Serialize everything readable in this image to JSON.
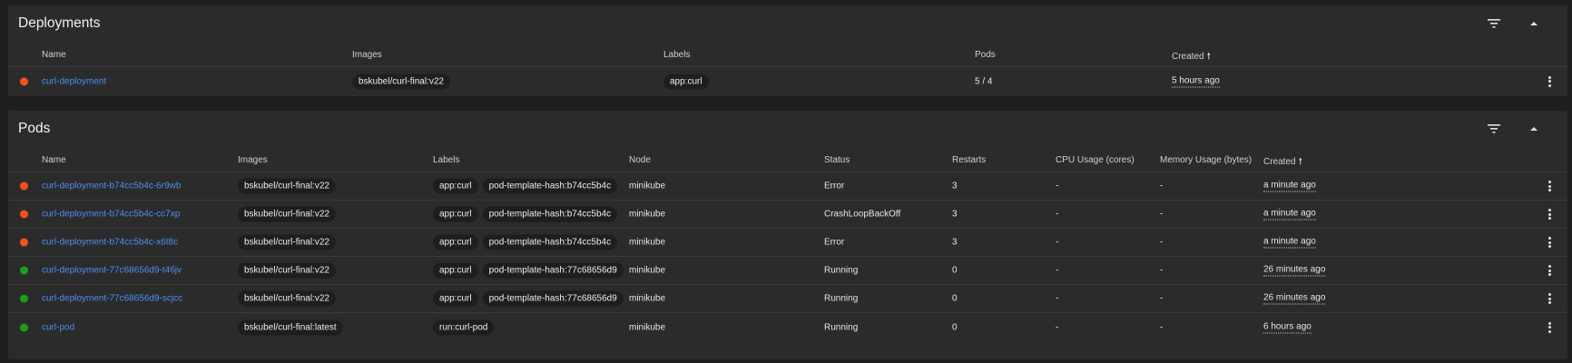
{
  "deployments": {
    "title": "Deployments",
    "columns": {
      "name": "Name",
      "images": "Images",
      "labels": "Labels",
      "pods": "Pods",
      "created": "Created"
    },
    "rows": [
      {
        "status": "error",
        "name": "curl-deployment",
        "image": "bskubel/curl-final:v22",
        "label": "app:curl",
        "pods": "5 / 4",
        "created": "5 hours ago"
      }
    ]
  },
  "pods": {
    "title": "Pods",
    "columns": {
      "name": "Name",
      "images": "Images",
      "labels": "Labels",
      "node": "Node",
      "status": "Status",
      "restarts": "Restarts",
      "cpu": "CPU Usage (cores)",
      "memory": "Memory Usage (bytes)",
      "created": "Created"
    },
    "rows": [
      {
        "status": "error",
        "name": "curl-deployment-b74cc5b4c-6r9wb",
        "image": "bskubel/curl-final:v22",
        "label1": "app:curl",
        "label2": "pod-template-hash:b74cc5b4c",
        "node": "minikube",
        "state": "Error",
        "restarts": "3",
        "cpu": "-",
        "memory": "-",
        "created": "a minute ago"
      },
      {
        "status": "error",
        "name": "curl-deployment-b74cc5b4c-cc7xp",
        "image": "bskubel/curl-final:v22",
        "label1": "app:curl",
        "label2": "pod-template-hash:b74cc5b4c",
        "node": "minikube",
        "state": "CrashLoopBackOff",
        "restarts": "3",
        "cpu": "-",
        "memory": "-",
        "created": "a minute ago"
      },
      {
        "status": "error",
        "name": "curl-deployment-b74cc5b4c-x6t8c",
        "image": "bskubel/curl-final:v22",
        "label1": "app:curl",
        "label2": "pod-template-hash:b74cc5b4c",
        "node": "minikube",
        "state": "Error",
        "restarts": "3",
        "cpu": "-",
        "memory": "-",
        "created": "a minute ago"
      },
      {
        "status": "ok",
        "name": "curl-deployment-77c68656d9-t46jv",
        "image": "bskubel/curl-final:v22",
        "label1": "app:curl",
        "label2": "pod-template-hash:77c68656d9",
        "node": "minikube",
        "state": "Running",
        "restarts": "0",
        "cpu": "-",
        "memory": "-",
        "created": "26 minutes ago"
      },
      {
        "status": "ok",
        "name": "curl-deployment-77c68656d9-scjcc",
        "image": "bskubel/curl-final:v22",
        "label1": "app:curl",
        "label2": "pod-template-hash:77c68656d9",
        "node": "minikube",
        "state": "Running",
        "restarts": "0",
        "cpu": "-",
        "memory": "-",
        "created": "26 minutes ago"
      },
      {
        "status": "ok",
        "name": "curl-pod",
        "image": "bskubel/curl-final:latest",
        "label1": "run:curl-pod",
        "label2": "",
        "node": "minikube",
        "state": "Running",
        "restarts": "0",
        "cpu": "-",
        "memory": "-",
        "created": "6 hours ago"
      }
    ]
  },
  "colors": {
    "error": "#f4511e",
    "ok": "#1b9e1b",
    "link": "#4d8ff0"
  },
  "icons": {
    "filter": "filter-icon",
    "collapse": "collapse-icon",
    "sort": "sort-arrow-up-icon",
    "more": "more-vert-icon"
  }
}
